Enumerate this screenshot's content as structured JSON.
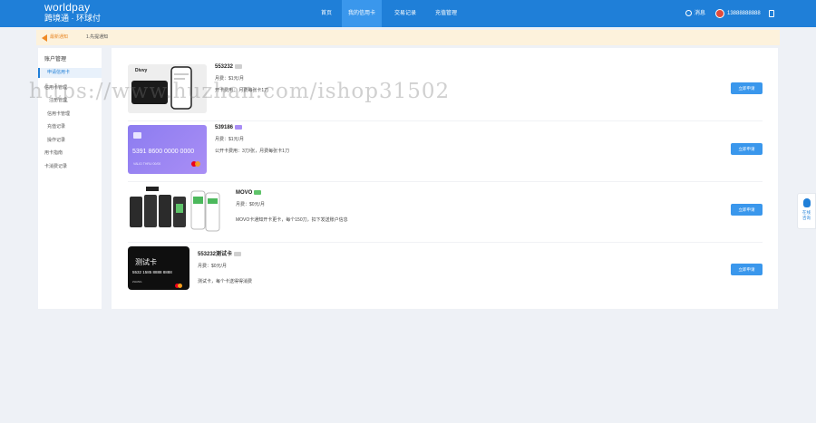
{
  "header": {
    "logo_line1": "worldpay",
    "logo_line2": "跨境通 · 环球付",
    "nav": [
      {
        "label": "首页"
      },
      {
        "label": "我的信用卡"
      },
      {
        "label": "交易记录"
      },
      {
        "label": "充值管理"
      }
    ],
    "notification_label": "消息",
    "phone": "13888888888"
  },
  "notice": {
    "tag": "最新通知",
    "text": "1.先提通知"
  },
  "sidebar": {
    "title": "账户管理",
    "items": [
      {
        "label": "申请信用卡"
      },
      {
        "label": "信用卡管理"
      },
      {
        "label": "注册管理"
      },
      {
        "label": "信用卡管理"
      },
      {
        "label": "充值记录"
      },
      {
        "label": "操作记录"
      },
      {
        "label": "用卡指南"
      },
      {
        "label": "卡消费记录"
      }
    ]
  },
  "cards": [
    {
      "name": "553232",
      "fee": "月费：$1元/月",
      "desc": "开卡费用：     月费每张卡1刀",
      "button": "立即申请",
      "image_text": "Divvy"
    },
    {
      "name": "539186",
      "fee": "月费：$1元/月",
      "desc": "公开卡费用：3刀/张，月费每张卡1刀",
      "button": "立即申请",
      "image_text": "5391 8600 0000 0000",
      "image_sub": "VALID THRU 00/00"
    },
    {
      "name": "MOVO",
      "fee": "月费：$0元/月",
      "desc": "MOVO卡通知开卡更卡，每个150刀，扣下发送账户信息",
      "button": "立即申请",
      "image_text": ""
    },
    {
      "name": "553232测试卡",
      "fee": "月费：$0元/月",
      "desc": "测试卡，每个卡送得得消费",
      "button": "立即申请",
      "image_text": "测试卡",
      "image_sub": "5532 1585 8888 8888",
      "image_holder": "ZHANG"
    }
  ],
  "watermark": "https://www.huzhan.com/ishop31502",
  "chat": {
    "line1": "在线",
    "line2": "咨询"
  },
  "colors": {
    "primary": "#1f7fd8",
    "notice_bg": "#fdf2dc",
    "button": "#3a97ec"
  }
}
